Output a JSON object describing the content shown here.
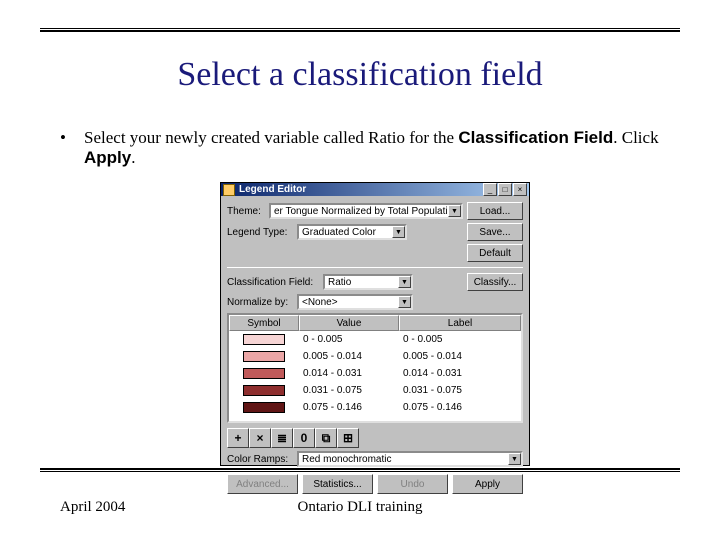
{
  "title": "Select a classification field",
  "bullet": {
    "pre": "Select your newly created variable called Ratio for the ",
    "bold1": "Classification Field",
    "mid": ". Click ",
    "bold2": "Apply",
    "post": "."
  },
  "dialog": {
    "title": "Legend Editor",
    "rows": {
      "theme_label": "Theme:",
      "theme_value": "er Tongue Normalized by Total Population",
      "legend_type_label": "Legend Type:",
      "legend_type_value": "Graduated Color",
      "class_field_label": "Classification Field:",
      "class_field_value": "Ratio",
      "normalize_label": "Normalize by:",
      "normalize_value": "<None>",
      "color_ramps_label": "Color Ramps:",
      "color_ramps_value": "Red monochromatic"
    },
    "buttons": {
      "load": "Load...",
      "save": "Save...",
      "default": "Default",
      "classify": "Classify...",
      "advanced": "Advanced...",
      "statistics": "Statistics...",
      "undo": "Undo",
      "apply": "Apply"
    },
    "grid": {
      "headers": {
        "symbol": "Symbol",
        "value": "Value",
        "label": "Label"
      },
      "rows": [
        {
          "color": "#f6d4d4",
          "value": "0 - 0.005",
          "label": "0 - 0.005"
        },
        {
          "color": "#eba6a6",
          "value": "0.005 - 0.014",
          "label": "0.005 - 0.014"
        },
        {
          "color": "#c05a5a",
          "value": "0.014 - 0.031",
          "label": "0.014 - 0.031"
        },
        {
          "color": "#8e2e2e",
          "value": "0.031 - 0.075",
          "label": "0.031 - 0.075"
        },
        {
          "color": "#601515",
          "value": "0.075 - 0.146",
          "label": "0.075 - 0.146"
        }
      ]
    },
    "tool_icons": [
      "+",
      "×",
      "≣",
      "0",
      "⧉",
      "⊞"
    ]
  },
  "footer": {
    "left": "April 2004",
    "center": "Ontario DLI training"
  }
}
